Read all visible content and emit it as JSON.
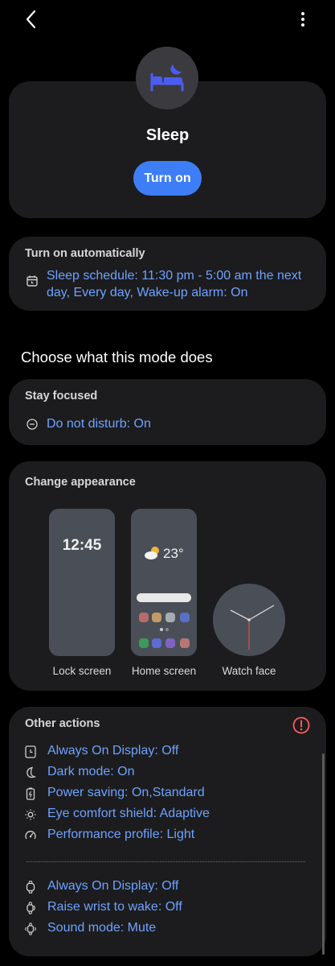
{
  "header": {
    "back": "back",
    "more": "more"
  },
  "mode": {
    "title": "Sleep",
    "turn_on_label": "Turn on",
    "icon": "bed-moon-icon"
  },
  "auto": {
    "title": "Turn on automatically",
    "schedule_line1": "Sleep schedule: 11:30 pm - 5:00 am the next",
    "schedule_line2": "day, Every day, Wake-up alarm: On"
  },
  "choose_heading": "Choose what this mode does",
  "focus": {
    "title": "Stay focused",
    "dnd": "Do not disturb: On"
  },
  "appearance": {
    "title": "Change appearance",
    "lock_time": "12:45",
    "temp": "23°",
    "lock_caption": "Lock screen",
    "home_caption": "Home screen",
    "watch_caption": "Watch face"
  },
  "other": {
    "title": "Other actions",
    "phone_actions": [
      "Always On Display: Off",
      "Dark mode: On",
      "Power saving: On,Standard",
      "Eye comfort shield: Adaptive",
      "Performance profile: Light"
    ],
    "watch_actions": [
      "Always On Display: Off",
      "Raise wrist to wake: Off",
      "Sound mode: Mute"
    ]
  },
  "colors": {
    "accent": "#3d7ef7",
    "link": "#6ea2ff",
    "warning": "#ff5b5b",
    "card": "#1c1c1e"
  }
}
